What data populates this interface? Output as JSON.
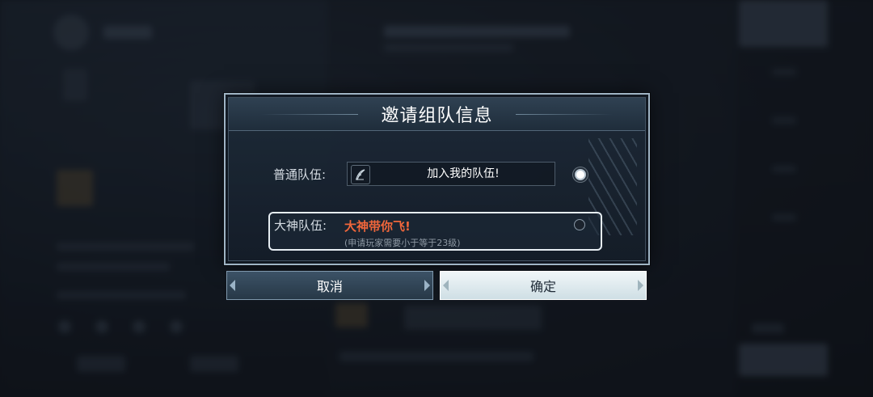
{
  "dialog": {
    "title": "邀请组队信息"
  },
  "normal_team": {
    "label": "普通队伍:",
    "message": "加入我的队伍!",
    "selected": true,
    "pen_icon": "feather-pen-icon"
  },
  "god_team": {
    "label": "大神队伍:",
    "slogan": "大神带你飞!",
    "note": "(申请玩家需要小于等于23级)",
    "selected": false
  },
  "buttons": {
    "cancel": "取消",
    "confirm": "确定"
  },
  "colors": {
    "slogan": "#f0663b",
    "confirm_bg": "#e3eef2",
    "cancel_bg": "#324657",
    "border": "#9fb4c4"
  }
}
